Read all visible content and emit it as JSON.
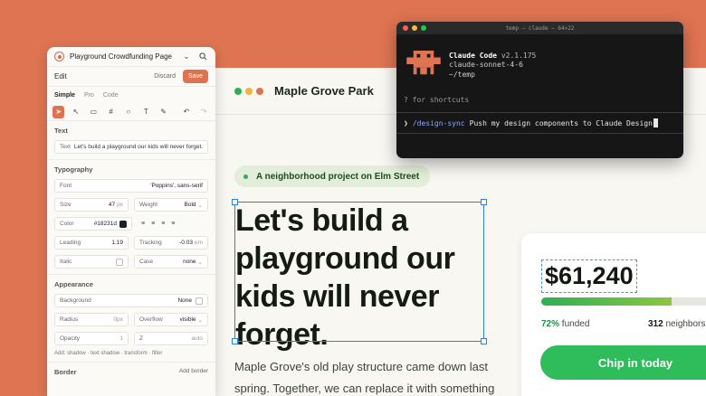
{
  "site": {
    "brand": "Maple Grove Park",
    "dot_colors": [
      "#2fae58",
      "#f2b33d",
      "#e0724f"
    ],
    "pill": "A neighborhood project on Elm Street",
    "headline": "Let's build a playground our kids will never forget.",
    "body": "Maple Grove's old play structure came down last spring. Together, we can replace it with something",
    "card": {
      "amount": "$61,240",
      "funded_fraction": 0.72,
      "funded_pct": "72%",
      "funded_label": "funded",
      "neighbors_count": "312",
      "neighbors_label": "neighbors",
      "cta": "Chip in today"
    }
  },
  "panel": {
    "page_name": "Playground Crowdfunding Page",
    "mode_label": "Edit",
    "discard": "Discard",
    "save": "Save",
    "tabs": [
      "Simple",
      "Pro",
      "Code"
    ],
    "text_section": "Text",
    "text_field_label": "Text",
    "text_field_value": "Let's build a playground our kids will never forget.",
    "typography": "Typography",
    "font_label": "Font",
    "font_value": "'Poppins', sans-serif",
    "size_label": "Size",
    "size_value": "47",
    "size_unit": "px",
    "weight_label": "Weight",
    "weight_value": "Bold",
    "color_label": "Color",
    "color_value": "#18231d",
    "leading_label": "Leading",
    "leading_value": "1.19",
    "tracking_label": "Tracking",
    "tracking_value": "-0.03",
    "tracking_unit": "em",
    "italic_label": "Italic",
    "case_label": "Case",
    "case_value": "none",
    "appearance": "Appearance",
    "background_label": "Background",
    "background_value": "None",
    "radius_label": "Radius",
    "radius_value": "0px",
    "overflow_label": "Overflow",
    "overflow_value": "visible",
    "opacity_label": "Opacity",
    "opacity_value": "1",
    "z_label": "Z",
    "z_value": "auto",
    "add_note": "Add: shadow · text shadow · transform · filter",
    "border_label": "Border",
    "add_border": "Add border"
  },
  "terminal": {
    "title": "temp — claude — 64×22",
    "app_name": "Claude Code",
    "version": "v2.1.175",
    "model": "claude-sonnet-4-6",
    "cwd": "~/temp",
    "hint": "? for shortcuts",
    "prompt_symbol": "❯",
    "command": "/design-sync",
    "command_text": "Push my design components to Claude Design",
    "traffic_colors": [
      "#ff5f57",
      "#febc2e",
      "#28c840"
    ]
  }
}
